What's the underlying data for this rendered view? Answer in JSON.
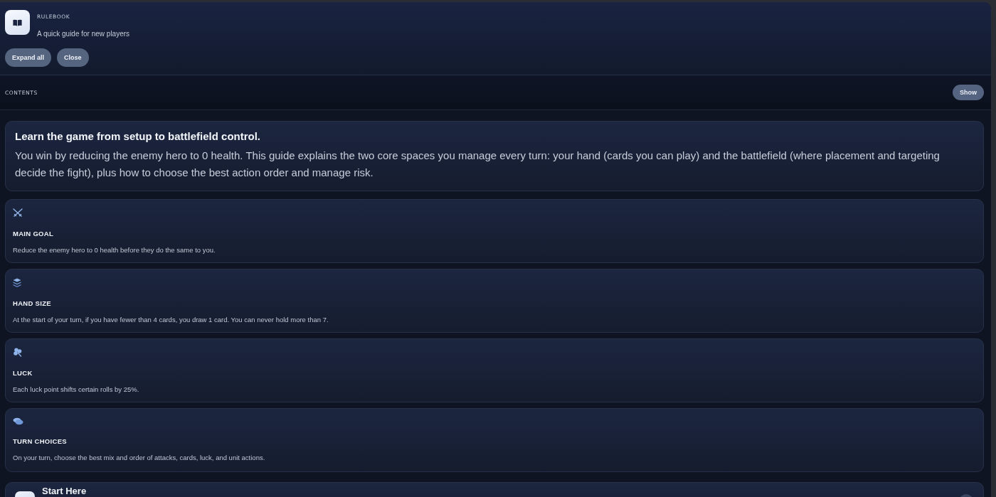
{
  "header": {
    "label": "RULEBOOK",
    "subtitle": "A quick guide for new players",
    "buttons": [
      "Expand all",
      "Close"
    ]
  },
  "contents": {
    "label": "CONTENTS",
    "button": "Show"
  },
  "intro": {
    "title": "Learn the game from setup to battlefield control.",
    "text": "You win by reducing the enemy hero to 0 health. This guide explains the two core spaces you manage every turn: your hand (cards you can play) and the battlefield (where placement and targeting decide the fight), plus how to choose the best action order and manage risk."
  },
  "rules": [
    {
      "kind": "goal",
      "title": "MAIN GOAL",
      "text": "Reduce the enemy hero to 0 health before they do the same to you."
    },
    {
      "kind": "hand",
      "title": "HAND SIZE",
      "text": "At the start of your turn, if you have fewer than 4 cards, you draw 1 card. You can never hold more than 7."
    },
    {
      "kind": "luck",
      "title": "LUCK",
      "text": "Each luck point shifts certain rolls by 25%."
    },
    {
      "kind": "turn",
      "title": "TURN CHOICES",
      "text": "On your turn, choose the best mix and order of attacks, cards, luck, and unit actions."
    }
  ],
  "sections": [
    {
      "title": "Start Here"
    }
  ]
}
